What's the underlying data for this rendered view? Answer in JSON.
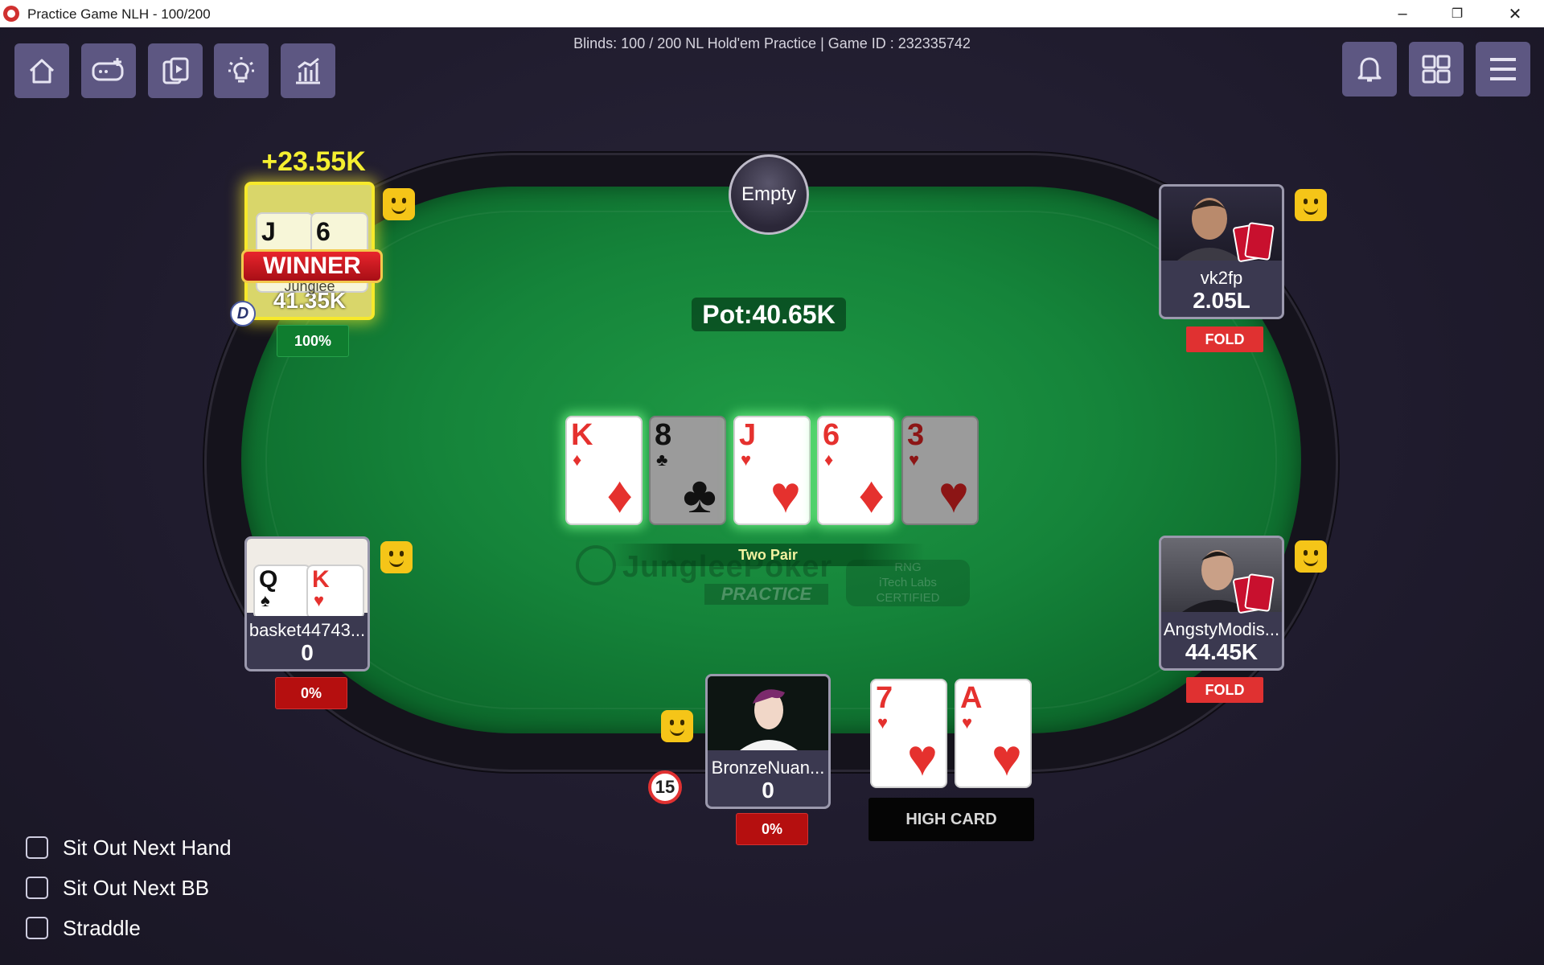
{
  "window": {
    "title": "Practice Game NLH - 100/200"
  },
  "header": {
    "blinds_text": "Blinds: 100 / 200  NL Hold'em Practice | Game ID : 232335742"
  },
  "toolbar_left": [
    "home-icon",
    "add-game-icon",
    "cards-icon",
    "lightbulb-icon",
    "stats-icon"
  ],
  "toolbar_right": [
    "bell-icon",
    "grid-icon",
    "menu-icon"
  ],
  "table": {
    "empty_seat": "Empty",
    "pot": "Pot:40.65K",
    "board": [
      {
        "rank": "K",
        "suit": "♦",
        "color": "red"
      },
      {
        "rank": "8",
        "suit": "♣",
        "color": "black"
      },
      {
        "rank": "J",
        "suit": "♥",
        "color": "red"
      },
      {
        "rank": "6",
        "suit": "♦",
        "color": "red"
      },
      {
        "rank": "3",
        "suit": "♥",
        "color": "red"
      }
    ],
    "hand_label": "Two Pair",
    "watermark": {
      "brand": "JungleePoker",
      "practice": "PRACTICE",
      "rng": "RNG",
      "rng2": "iTech Labs",
      "rng3": "CERTIFIED"
    }
  },
  "players": {
    "winner": {
      "name": "Junglee",
      "stack": "41.35K",
      "gain": "+23.55K",
      "banner": "WINNER",
      "equity": "100%",
      "cards": [
        {
          "rank": "J",
          "suit": "♣"
        },
        {
          "rank": "6",
          "suit": "♠"
        }
      ],
      "dealer": "D"
    },
    "vk2fp": {
      "name": "vk2fp",
      "stack": "2.05L",
      "status": "FOLD"
    },
    "basket": {
      "name": "basket44743...",
      "stack": "0",
      "equity": "0%",
      "cards": [
        {
          "rank": "Q",
          "suit": "♠"
        },
        {
          "rank": "K",
          "suit": "♥"
        }
      ]
    },
    "angsty": {
      "name": "AngstyModis...",
      "stack": "44.45K",
      "status": "FOLD"
    },
    "hero": {
      "name": "BronzeNuan...",
      "stack": "0",
      "equity": "0%",
      "timer": "15",
      "cards": [
        {
          "rank": "7",
          "suit": "♥"
        },
        {
          "rank": "A",
          "suit": "♥"
        }
      ],
      "hand": "HIGH CARD"
    }
  },
  "options": [
    "Sit Out Next Hand",
    "Sit Out Next BB",
    "Straddle"
  ],
  "colors": {
    "felt": "#15843a",
    "button_bg": "#5d5782",
    "fold": "#e03131",
    "winner_glow": "#f7e92b"
  }
}
